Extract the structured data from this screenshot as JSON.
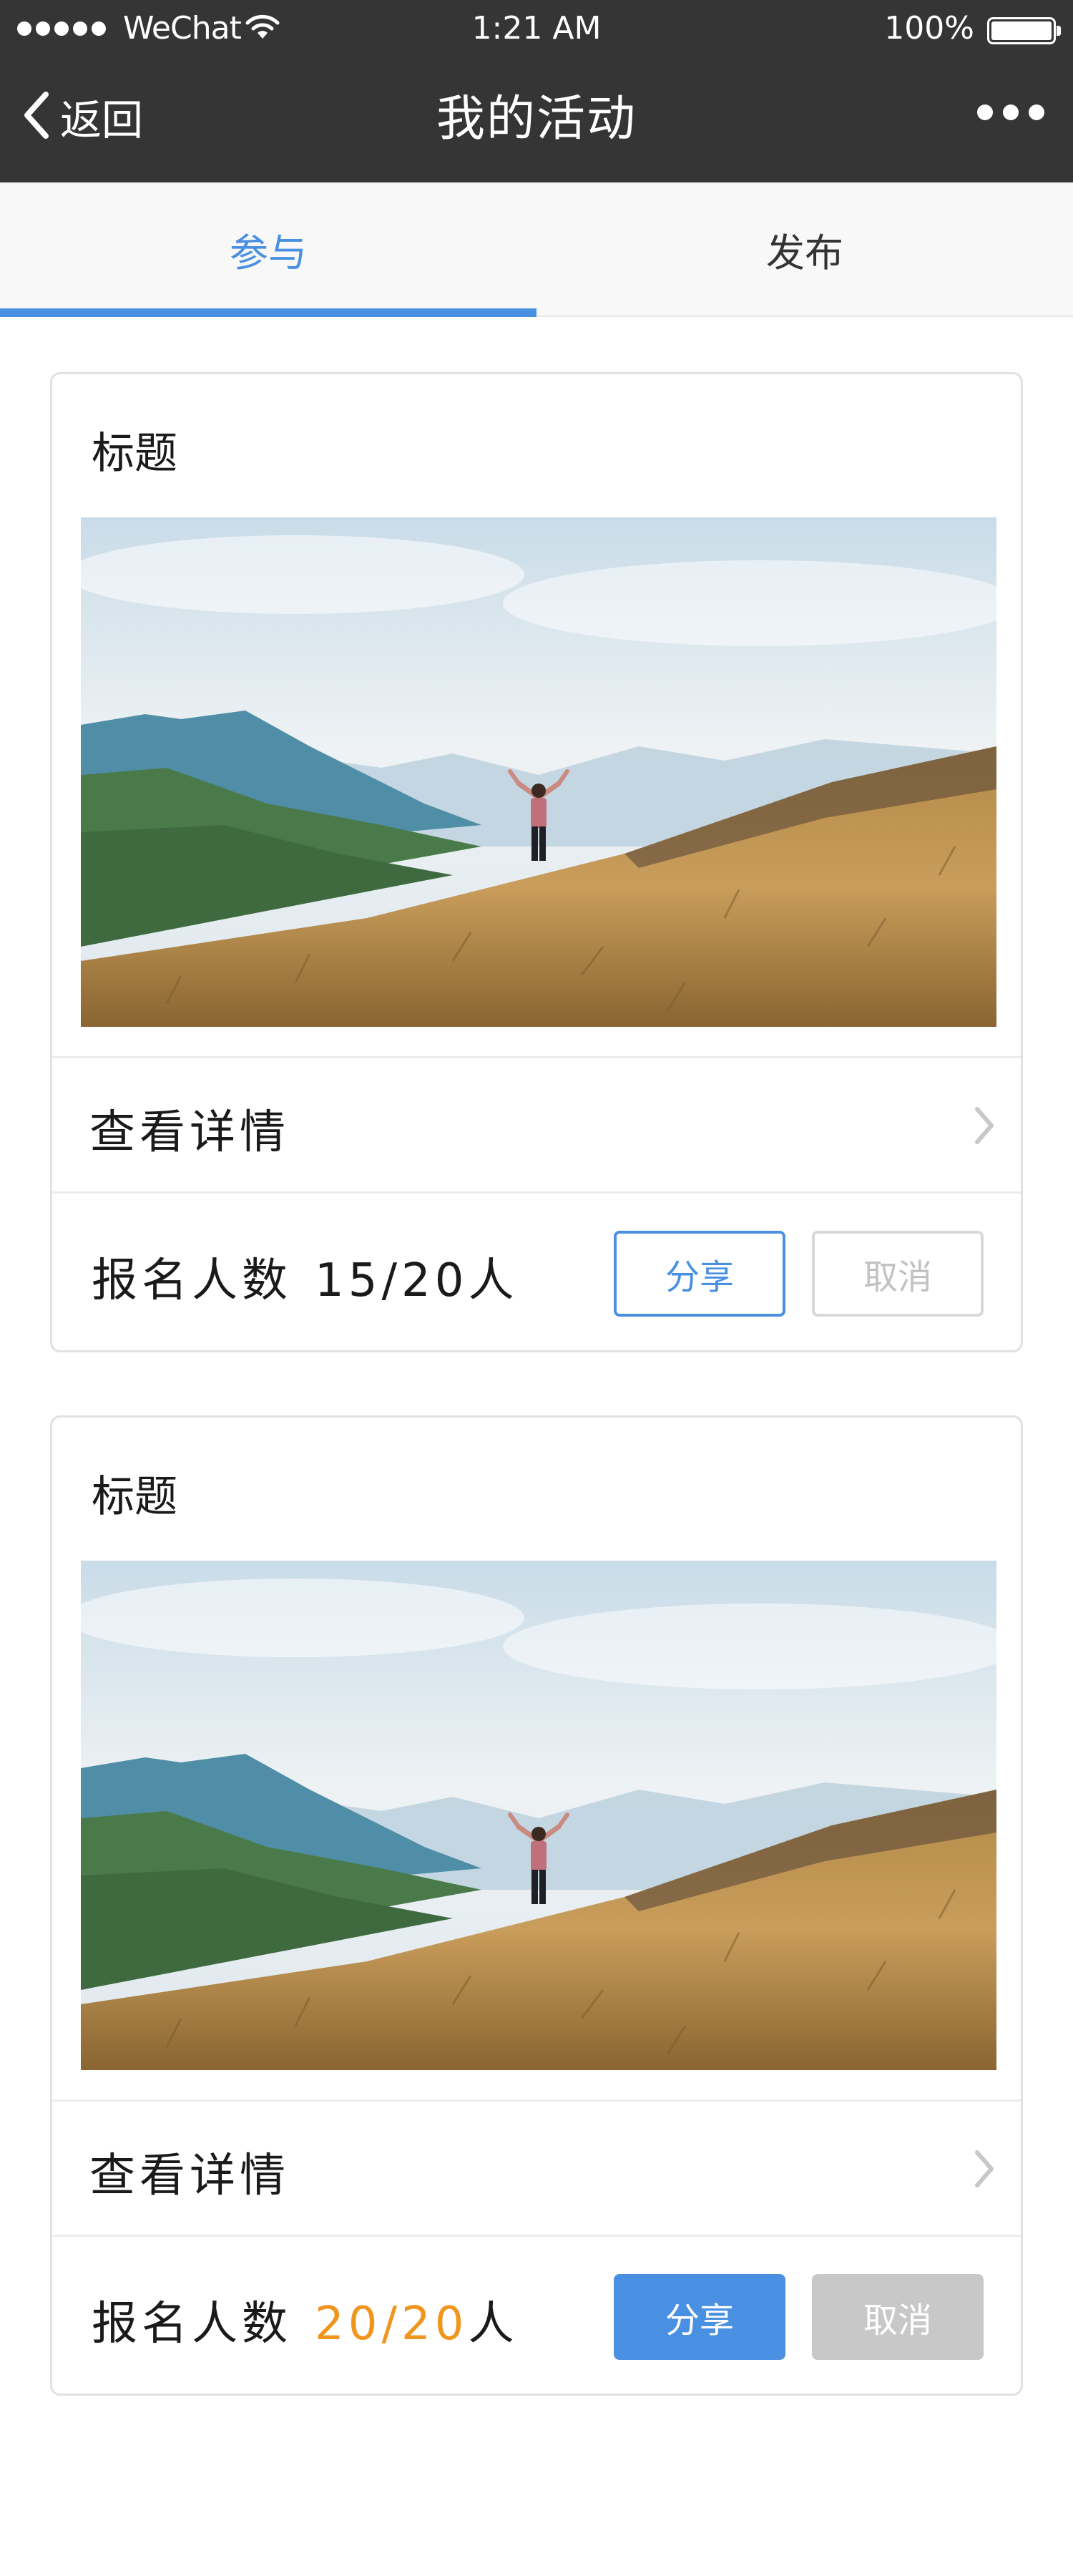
{
  "status_bar": {
    "carrier": "WeChat",
    "time": "1:21 AM",
    "battery": "100%"
  },
  "nav": {
    "back_label": "返回",
    "title": "我的活动"
  },
  "tabs": [
    {
      "label": "参与",
      "active": true
    },
    {
      "label": "发布",
      "active": false
    }
  ],
  "cards": [
    {
      "title": "标题",
      "details_label": "查看详情",
      "signup_label": "报名人数",
      "signup_count": "15/20",
      "signup_unit": "人",
      "share_label": "分享",
      "cancel_label": "取消"
    },
    {
      "title": "标题",
      "details_label": "查看详情",
      "signup_label": "报名人数",
      "signup_count": "20/20",
      "signup_unit": "人",
      "share_label": "分享",
      "cancel_label": "取消"
    }
  ],
  "colors": {
    "accent": "#4a90e2",
    "full_count": "#f0961e",
    "nav_bg": "#353535",
    "disabled_button": "#c8c8c8"
  }
}
